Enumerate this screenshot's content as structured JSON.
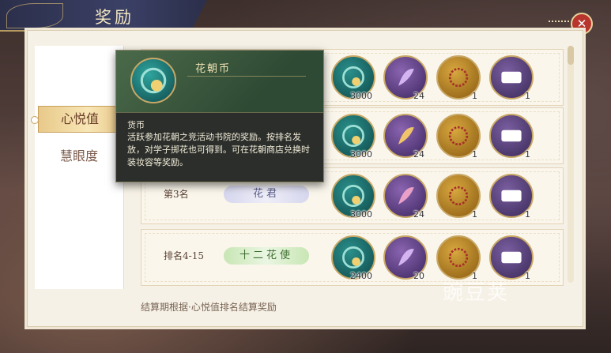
{
  "header": {
    "title": "奖励"
  },
  "sidebar": {
    "tabs": [
      {
        "label": "心悦值"
      },
      {
        "label": "慧眼度"
      }
    ]
  },
  "rows": [
    {
      "rank": "",
      "title": "",
      "rewards": [
        "3000",
        "24",
        "1",
        "1"
      ]
    },
    {
      "rank": "",
      "title": "",
      "rewards": [
        "3000",
        "24",
        "1",
        "1"
      ]
    },
    {
      "rank": "第3名",
      "title": "花君",
      "rewards": [
        "3000",
        "24",
        "1",
        "1"
      ]
    },
    {
      "rank": "排名4-15",
      "title": "十二花使",
      "rewards": [
        "2400",
        "20",
        "1",
        "1"
      ]
    }
  ],
  "item_icons": [
    "coin-flower-icon",
    "feather-icon",
    "wreath-icon",
    "scroll-icon"
  ],
  "footer": {
    "note": "结算期根据·心悦值排名结算奖励"
  },
  "tooltip": {
    "name": "花朝币",
    "category": "货币",
    "description": "活跃参加花朝之竞活动书院的奖励。按排名发放，对学子掷花也可得到。可在花朝商店兑换时装妆容等奖励。"
  },
  "watermark": "豌豆荚",
  "colors": {
    "accent": "#c9a866",
    "close": "#b8352e",
    "tooltip_bg": "#2b2e2b"
  }
}
